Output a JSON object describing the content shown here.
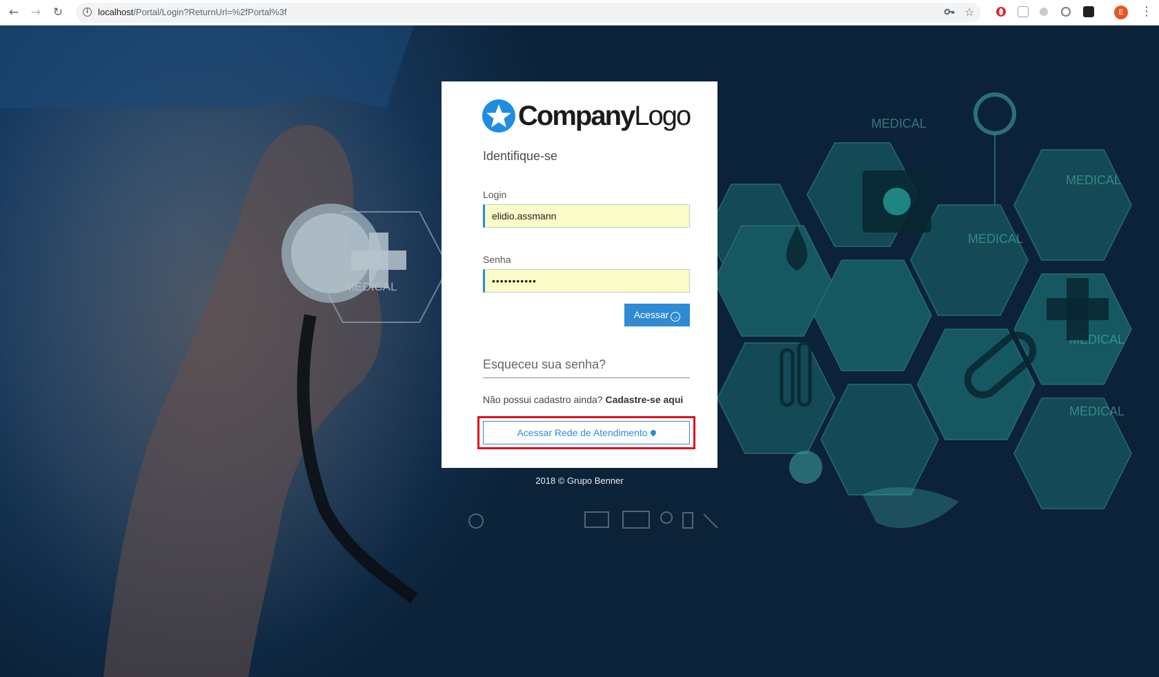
{
  "browser": {
    "url_host": "localhost",
    "url_path": "/Portal/Login?ReturnUrl=%2fPortal%3f",
    "profile_initial": "E"
  },
  "background": {
    "labels": [
      "MEDICAL",
      "MEDICAL",
      "MEDICAL",
      "MEDICAL",
      "MEDICAL",
      "MEDICAL"
    ]
  },
  "login": {
    "logo_bold": "Company",
    "logo_light": "Logo",
    "title": "Identifique-se",
    "login_label": "Login",
    "login_value": "elidio.assmann",
    "password_label": "Senha",
    "password_value": "•••••••••••",
    "submit_label": "Acessar",
    "forgot_label": "Esqueceu sua senha?",
    "no_account_text": "Não possui cadastro ainda?",
    "register_link": "Cadastre-se aqui",
    "network_button": "Acessar Rede de Atendimento"
  },
  "footer": {
    "text": "2018 © Grupo Benner"
  },
  "colors": {
    "accent": "#2f8bd3",
    "autofill": "#fbfcc7",
    "highlight": "#e10e1c",
    "logo_blue": "#1f8ee0"
  }
}
